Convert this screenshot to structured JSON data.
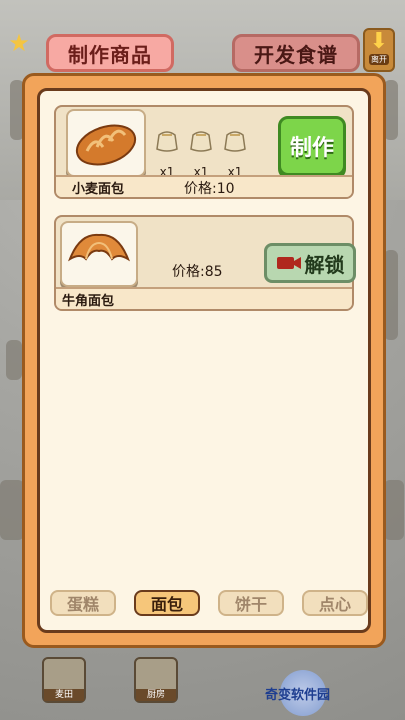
{
  "tabs": {
    "make": "制作商品",
    "recipes": "开发食谱"
  },
  "corner_button": {
    "label": "离开"
  },
  "products": [
    {
      "name": "小麦面包",
      "price_label": "价格:10",
      "ingredients": [
        {
          "icon": "flour-sack-icon",
          "qty": "x1"
        },
        {
          "icon": "flour-sack-icon",
          "qty": "x1"
        },
        {
          "icon": "flour-sack-icon",
          "qty": "x1"
        }
      ],
      "action": "制作"
    },
    {
      "name": "牛角面包",
      "price_label": "价格:85",
      "action": "解锁"
    }
  ],
  "categories": [
    {
      "label": "蛋糕",
      "active": false
    },
    {
      "label": "面包",
      "active": true
    },
    {
      "label": "饼干",
      "active": false
    },
    {
      "label": "点心",
      "active": false
    }
  ],
  "bottom_nav": [
    {
      "label": "麦田"
    },
    {
      "label": "厨房"
    }
  ],
  "watermark": "奇变软件园",
  "colors": {
    "accent_green": "#7dd54a",
    "panel_orange": "#f2a45a",
    "tab_pink": "#f7a9a3"
  }
}
